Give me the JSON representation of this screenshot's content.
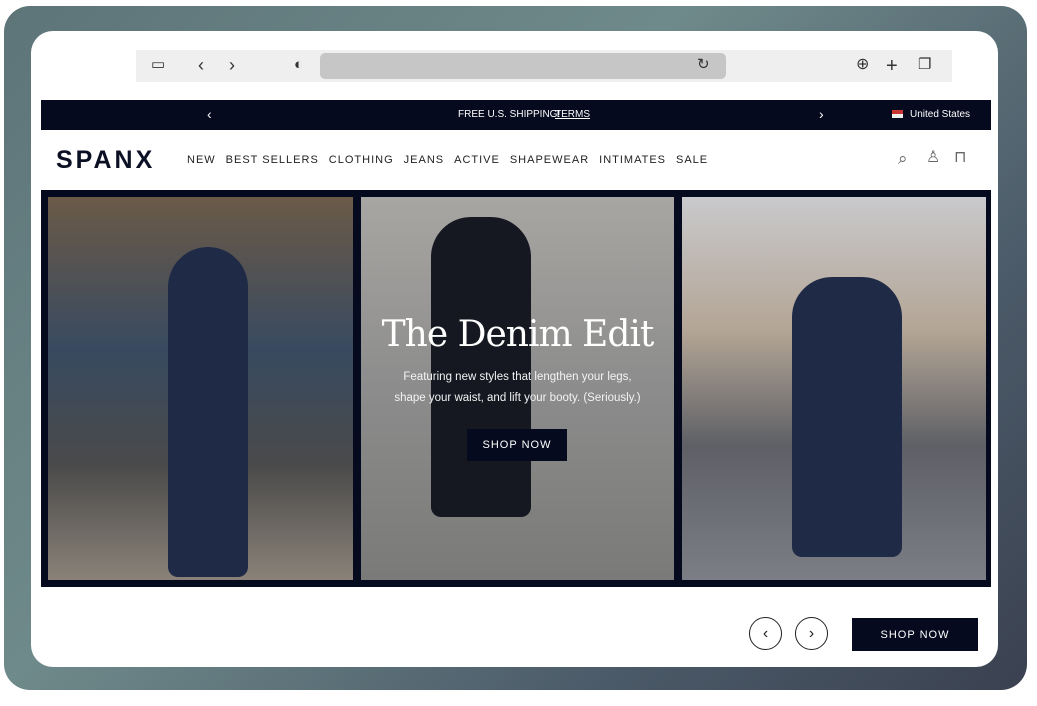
{
  "browser": {
    "icons": [
      "sidebar-icon",
      "back-icon",
      "forward-icon",
      "shield-icon",
      "reload-icon",
      "download-icon",
      "new-tab-icon",
      "tabs-icon"
    ]
  },
  "promo": {
    "text": "FREE U.S. SHIPPING!",
    "link": "TERMS",
    "region": "United States"
  },
  "nav": {
    "logo": "SPANX",
    "items": [
      "NEW",
      "BEST SELLERS",
      "CLOTHING",
      "JEANS",
      "ACTIVE",
      "SHAPEWEAR",
      "INTIMATES",
      "SALE"
    ]
  },
  "hero": {
    "title": "The Denim Edit",
    "subtitle_line1": "Featuring new styles that lengthen your legs,",
    "subtitle_line2": "shape your waist, and lift your booty. (Seriously.)",
    "cta": "SHOP NOW"
  },
  "footer": {
    "cta": "SHOP NOW"
  }
}
